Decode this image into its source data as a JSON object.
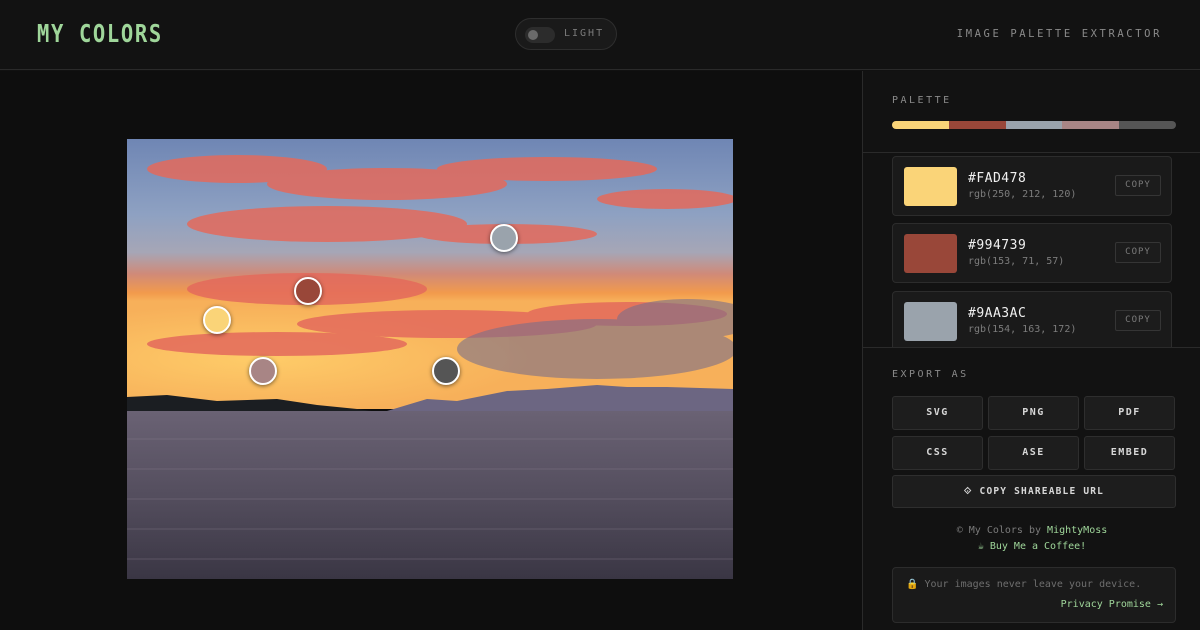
{
  "header": {
    "logo": "MY COLORS",
    "theme_toggle_label": "LIGHT",
    "tagline": "IMAGE PALETTE EXTRACTOR"
  },
  "colors": {
    "accent": "#9fd69a",
    "background": "#111111"
  },
  "photo": {
    "pickers": [
      {
        "color": "#FAD478"
      },
      {
        "color": "#994739"
      },
      {
        "color": "#9AA3AC"
      },
      {
        "color": "#A88585"
      },
      {
        "color": "#555555"
      }
    ]
  },
  "sidebar": {
    "palette_label": "PALETTE",
    "palette_bar": [
      "#FAD478",
      "#994739",
      "#9AA3AC",
      "#A88585",
      "#555555"
    ],
    "swatches": [
      {
        "hex": "#FAD478",
        "rgb": "rgb(250, 212, 120)",
        "copy_label": "COPY"
      },
      {
        "hex": "#994739",
        "rgb": "rgb(153, 71, 57)",
        "copy_label": "COPY"
      },
      {
        "hex": "#9AA3AC",
        "rgb": "rgb(154, 163, 172)",
        "copy_label": "COPY"
      }
    ],
    "export_label": "EXPORT AS",
    "export_buttons": [
      "SVG",
      "PNG",
      "PDF",
      "CSS",
      "ASE",
      "EMBED"
    ],
    "share_button": "⟐ COPY SHAREABLE URL",
    "credit_prefix": "© My Colors by",
    "credit_author": "MightyMoss",
    "coffee_link": "☕ Buy Me a Coffee!",
    "privacy_text": "🔒 Your images never leave your device.",
    "privacy_link": "Privacy Promise →"
  }
}
